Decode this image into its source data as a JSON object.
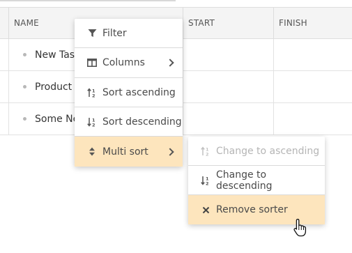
{
  "grid": {
    "columns": [
      "NAME",
      "START",
      "FINISH"
    ],
    "rows": [
      {
        "name": "New Task",
        "start": "",
        "finish": ""
      },
      {
        "name": "Product Review",
        "start": "",
        "finish": ""
      },
      {
        "name": "Some New Task",
        "start": "",
        "finish": ""
      }
    ]
  },
  "context_menu": {
    "items": [
      {
        "label": "Filter",
        "icon": "filter-icon"
      },
      {
        "label": "Columns",
        "icon": "columns-icon",
        "submenu": true
      },
      {
        "label": "Sort ascending",
        "icon": "sort-ascending-icon"
      },
      {
        "label": "Sort descending",
        "icon": "sort-descending-icon"
      },
      {
        "label": "Multi sort",
        "icon": "multi-sort-icon",
        "submenu": true,
        "active": true
      }
    ]
  },
  "submenu": {
    "items": [
      {
        "label": "Change to ascending",
        "icon": "sort-ascending-icon",
        "disabled": true
      },
      {
        "label": "Change to descending",
        "icon": "sort-descending-icon"
      },
      {
        "label": "Remove sorter",
        "icon": "close-icon",
        "hovered": true
      }
    ]
  },
  "colors": {
    "active_item_bg": "#fde5bd",
    "header_bg": "#f4f4f4",
    "disabled_text": "#b5b5b5"
  }
}
